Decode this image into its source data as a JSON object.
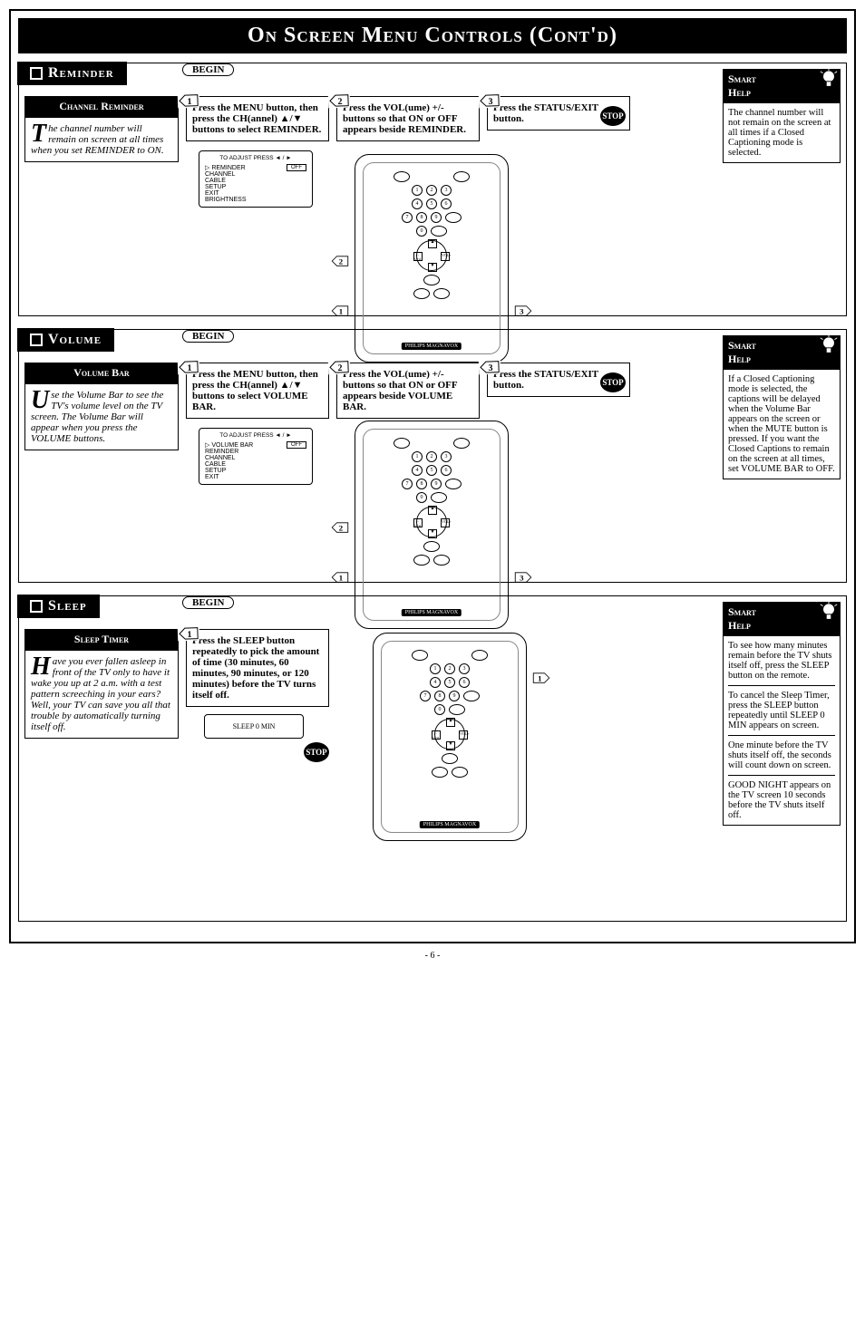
{
  "page_title": "On Screen Menu Controls (Cont'd)",
  "page_number": "- 6 -",
  "sections": [
    {
      "header": "Reminder",
      "begin": "BEGIN",
      "info_title": "Channel Reminder",
      "dropcap": "T",
      "desc": "he channel number will remain on screen at all times when you set REMINDER to ON.",
      "steps": [
        {
          "num": "1",
          "text_bold1": "Press the MENU button, then press the CH(annel) ▲/▼ buttons to select REMINDER.",
          "text": ""
        },
        {
          "num": "2",
          "text_bold1": "Press the VOL(ume) +/- buttons so that ON or OFF appears beside REMINDER.",
          "text": ""
        },
        {
          "num": "3",
          "text_bold1": "Press the STATUS/EXIT button.",
          "text": "",
          "stop": "STOP"
        }
      ],
      "osd": {
        "title": "TO ADJUST PRESS ◄ / ►",
        "items": [
          "REMINDER",
          "CHANNEL",
          "CABLE",
          "SETUP",
          "EXIT",
          "BRIGHTNESS"
        ],
        "selected": "REMINDER",
        "value": "OFF"
      },
      "remote_brand": "PHILIPS MAGNAVOX",
      "smart_help": {
        "title1": "Smart",
        "title2": "Help",
        "paragraphs": [
          "The channel number will not remain on the screen at all times if a Closed Captioning mode is selected."
        ]
      }
    },
    {
      "header": "Volume",
      "begin": "BEGIN",
      "info_title": "Volume Bar",
      "dropcap": "U",
      "desc": "se the Volume Bar to see the TV's volume level on the TV screen. The Volume Bar will appear when you press the VOLUME buttons.",
      "steps": [
        {
          "num": "1",
          "text_bold1": "Press the MENU button, then press the CH(annel) ▲/▼ buttons to select VOLUME BAR.",
          "text": ""
        },
        {
          "num": "2",
          "text_bold1": "Press the VOL(ume) +/- buttons so that ON or OFF appears beside VOLUME BAR.",
          "text": ""
        },
        {
          "num": "3",
          "text_bold1": "Press the STATUS/EXIT button.",
          "text": "",
          "stop": "STOP"
        }
      ],
      "osd": {
        "title": "TO ADJUST PRESS ◄ / ►",
        "items": [
          "VOLUME BAR",
          "REMINDER",
          "CHANNEL",
          "CABLE",
          "SETUP",
          "EXIT"
        ],
        "selected": "VOLUME BAR",
        "value": "OFF"
      },
      "remote_brand": "PHILIPS MAGNAVOX",
      "smart_help": {
        "title1": "Smart",
        "title2": "Help",
        "paragraphs": [
          "If a Closed Captioning mode is selected, the captions will be delayed when the Volume Bar appears on the screen or when the MUTE button is pressed. If you want the Closed Captions to remain on the screen at all times, set VOLUME BAR to OFF."
        ]
      }
    },
    {
      "header": "Sleep",
      "begin": "BEGIN",
      "info_title": "Sleep Timer",
      "dropcap": "H",
      "desc": "ave you ever fallen asleep in front of the TV only to have it wake you up at 2 a.m. with a test pattern screeching in your ears? Well, your TV can save you all that trouble by automatically turning itself off.",
      "steps": [
        {
          "num": "1",
          "text_bold1": "Press the SLEEP button repeatedly to pick the amount of time (30 minutes, 60 minutes, 90 minutes, or 120 minutes) before the TV turns itself off.",
          "text": "",
          "stop": "STOP"
        }
      ],
      "sleep_display": "SLEEP   0   MIN",
      "remote_brand": "PHILIPS MAGNAVOX",
      "smart_help": {
        "title1": "Smart",
        "title2": "Help",
        "paragraphs": [
          "To see how many minutes remain before the TV shuts itself off, press the SLEEP button on the remote.",
          "To cancel the Sleep Timer, press the SLEEP button repeatedly until SLEEP 0 MIN appears on screen.",
          "One minute before the TV shuts itself off, the seconds will count down on screen.",
          "GOOD NIGHT appears on the TV screen 10 seconds before the TV shuts itself off."
        ]
      }
    }
  ]
}
